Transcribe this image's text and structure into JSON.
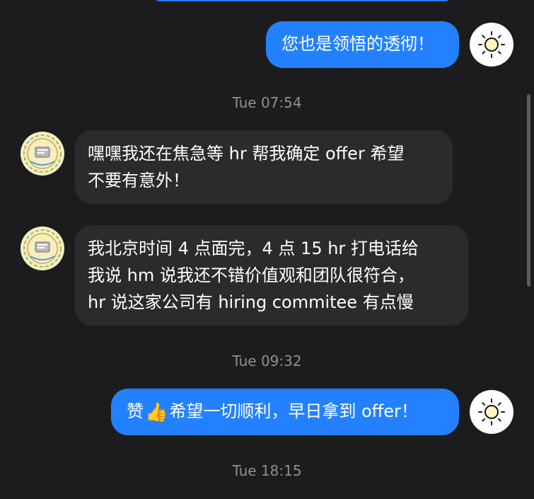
{
  "colors": {
    "outgoing_bubble": "#2381ff",
    "incoming_bubble": "#2b2b2e",
    "background": "#1c1c1e",
    "timestamp": "#8e8e93"
  },
  "messages": [
    {
      "direction": "outgoing",
      "avatar_icon": "sun-icon",
      "text": "您也是领悟的透彻！"
    },
    {
      "direction": "timestamp",
      "text": "Tue 07:54"
    },
    {
      "direction": "incoming",
      "avatar_icon": "contact-logo-avatar",
      "lines": [
        "嘿嘿我还在焦急等 hr 帮我确定 offer 希望",
        "不要有意外！"
      ]
    },
    {
      "direction": "incoming",
      "avatar_icon": "contact-logo-avatar",
      "lines": [
        "我北京时间 4 点面完，4 点 15 hr 打电话给",
        "我说 hm 说我还不错价值观和团队很符合，",
        "hr 说这家公司有 hiring commitee 有点慢"
      ]
    },
    {
      "direction": "timestamp",
      "text": "Tue 09:32"
    },
    {
      "direction": "outgoing",
      "avatar_icon": "sun-icon",
      "text_before": "赞",
      "emoji": "👍",
      "emoji_name": "thumbs-up-icon",
      "text_after": "希望一切顺利，早日拿到 offer！"
    },
    {
      "direction": "timestamp",
      "text": "Tue 18:15"
    }
  ]
}
